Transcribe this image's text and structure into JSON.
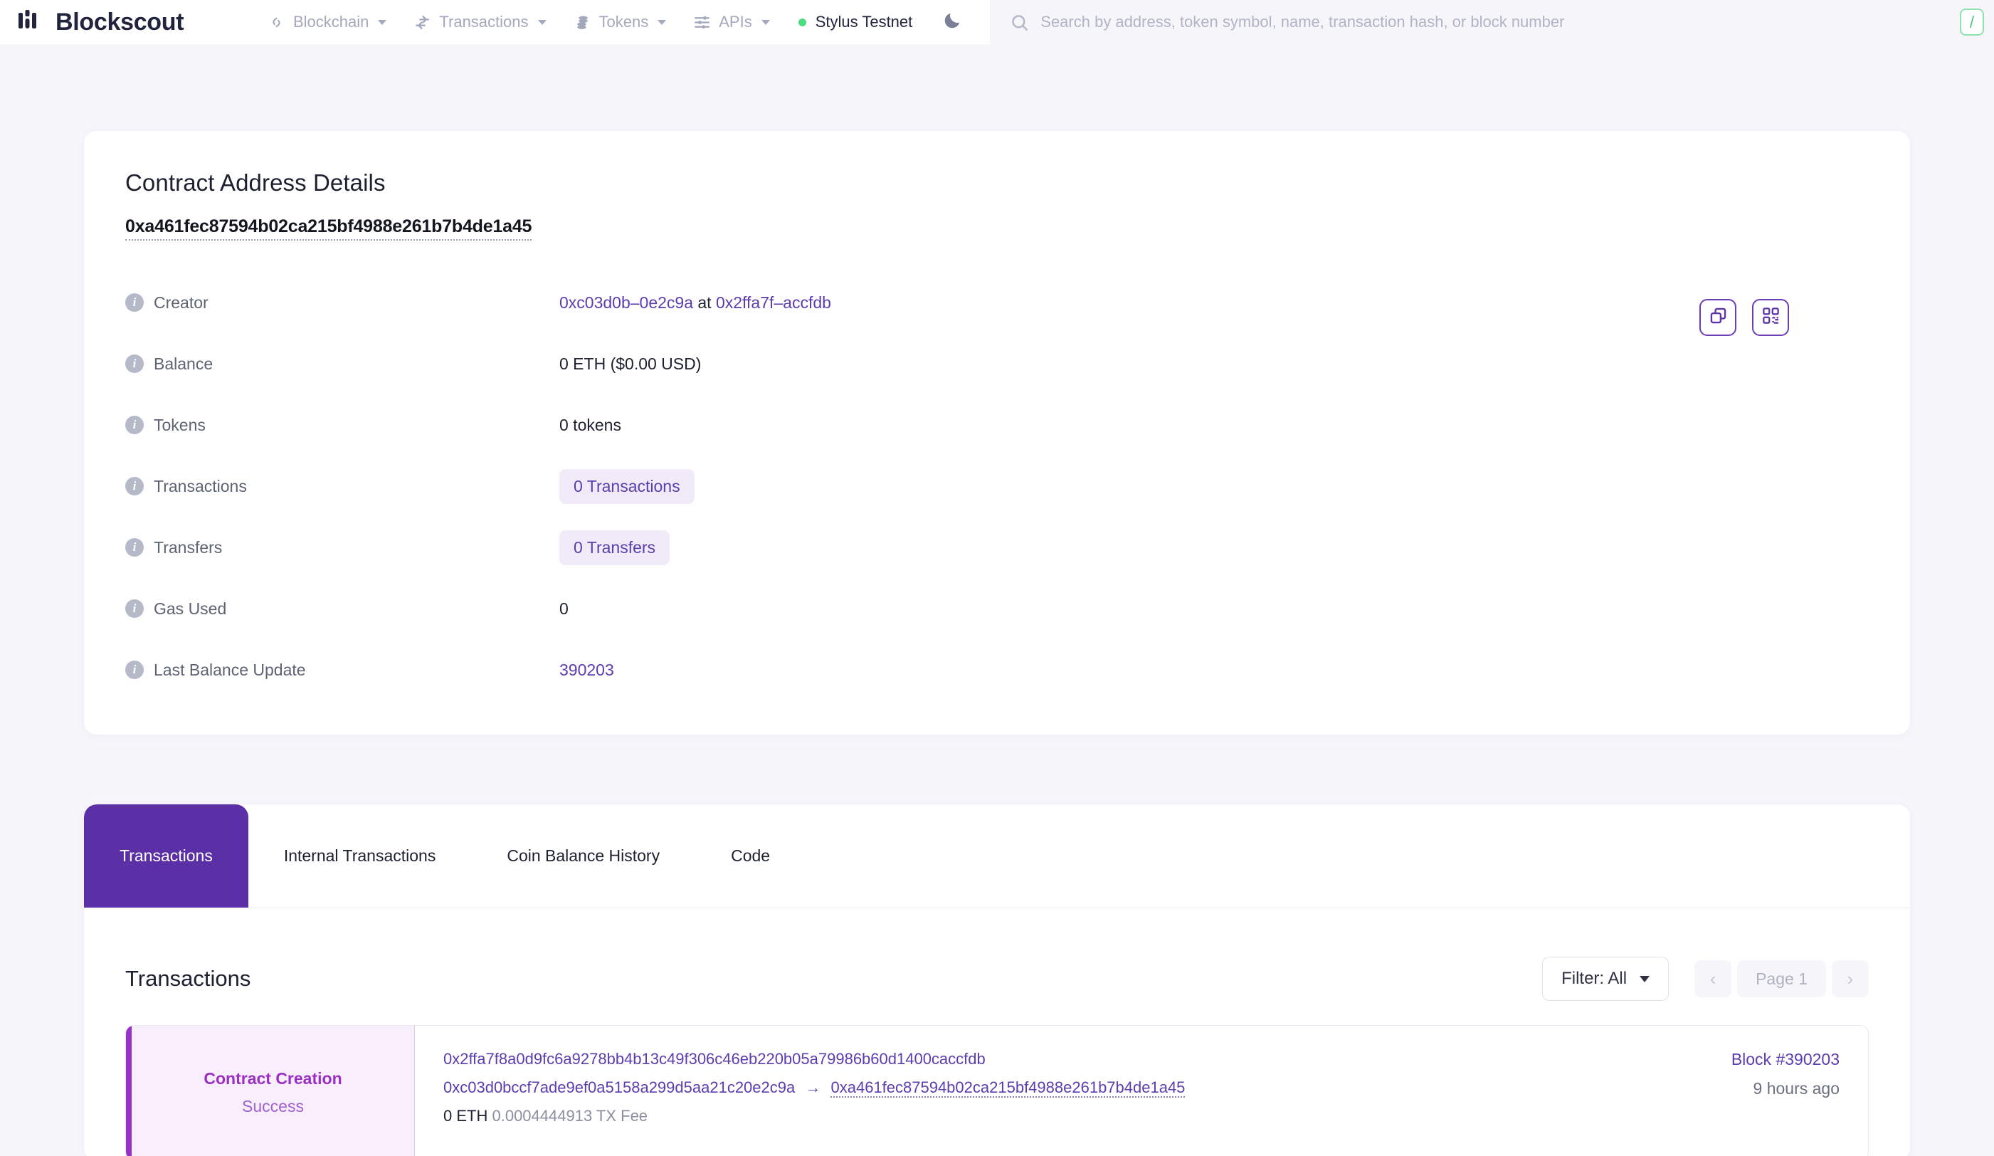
{
  "header": {
    "brand": "Blockscout",
    "nav_items": [
      {
        "label": "Blockchain",
        "icon": "blockchain-icon",
        "has_caret": true
      },
      {
        "label": "Transactions",
        "icon": "transactions-icon",
        "has_caret": true
      },
      {
        "label": "Tokens",
        "icon": "tokens-icon",
        "has_caret": true
      },
      {
        "label": "APIs",
        "icon": "apis-icon",
        "has_caret": true
      }
    ],
    "network": "Stylus Testnet",
    "theme_icon": "moon-icon",
    "search_placeholder": "Search by address, token symbol, name, transaction hash, or block number",
    "search_value": "",
    "search_shortcut": "/",
    "accent_color": "#5b30a6",
    "network_dot_color": "#4ade80",
    "shortcut_color": "#4fc97d"
  },
  "details": {
    "title": "Contract Address Details",
    "address": "0xa461fec87594b02ca215bf4988e261b7b4de1a45",
    "copy_button_icon": "copy-icon",
    "qr_button_icon": "qr-code-icon",
    "rows": [
      {
        "label": "Creator",
        "type": "creator",
        "creator": "0xc03d0b–0e2c9a",
        "at": "at",
        "tx": "0x2ffa7f–accfdb"
      },
      {
        "label": "Balance",
        "type": "text",
        "value": "0 ETH ($0.00 USD)"
      },
      {
        "label": "Tokens",
        "type": "text",
        "value": "0 tokens"
      },
      {
        "label": "Transactions",
        "type": "pill",
        "value": "0 Transactions"
      },
      {
        "label": "Transfers",
        "type": "pill",
        "value": "0 Transfers"
      },
      {
        "label": "Gas Used",
        "type": "text",
        "value": "0"
      },
      {
        "label": "Last Balance Update",
        "type": "link",
        "value": "390203"
      }
    ]
  },
  "tabs": {
    "items": [
      {
        "label": "Transactions",
        "active": true
      },
      {
        "label": "Internal Transactions",
        "active": false
      },
      {
        "label": "Coin Balance History",
        "active": false
      },
      {
        "label": "Code",
        "active": false
      }
    ]
  },
  "transactions_section": {
    "title": "Transactions",
    "filter_label": "Filter: All",
    "pager": {
      "prev": "‹",
      "page_label": "Page 1",
      "next": "›"
    },
    "rows": [
      {
        "type": "Contract Creation",
        "status": "Success",
        "hash": "0x2ffa7f8a0d9fc6a9278bb4b13c49f306c46eb220b05a79986b60d1400caccfdb",
        "from": "0xc03d0bccf7ade9ef0a5158a299d5aa21c20e2c9a",
        "arrow": "→",
        "to": "0xa461fec87594b02ca215bf4988e261b7b4de1a45",
        "value": "0 ETH",
        "fee": "0.0004444913 TX Fee",
        "block": "Block #390203",
        "age": "9 hours ago"
      }
    ]
  }
}
